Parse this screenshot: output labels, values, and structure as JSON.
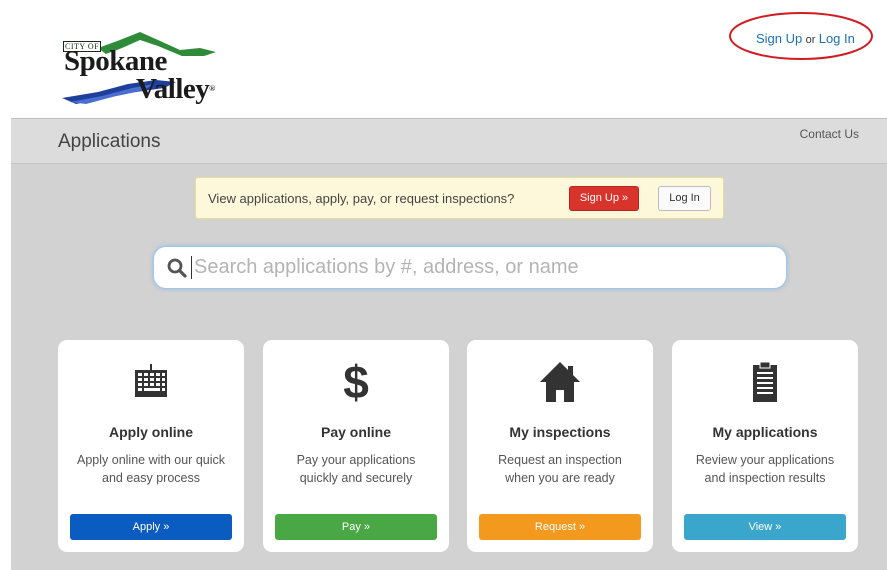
{
  "logo": {
    "city_of": "CITY OF",
    "line1": "Spokane",
    "line2": "Valley",
    "reg": "®"
  },
  "top_auth": {
    "signup": "Sign Up",
    "or": "or",
    "login": "Log In"
  },
  "header": {
    "title": "Applications",
    "contact": "Contact Us"
  },
  "banner": {
    "text": "View applications, apply, pay, or request inspections?",
    "signup_button": "Sign Up »",
    "login_button": "Log In"
  },
  "search": {
    "placeholder": "Search applications by #, address, or name",
    "value": ""
  },
  "cards": [
    {
      "icon": "keyboard-icon",
      "title": "Apply online",
      "desc1": "Apply online with our quick",
      "desc2": "and easy process",
      "button": "Apply »",
      "color": "#0b5cc0"
    },
    {
      "icon": "dollar-icon",
      "title": "Pay online",
      "desc1": "Pay your applications",
      "desc2": "quickly and securely",
      "button": "Pay »",
      "color": "#4aa745"
    },
    {
      "icon": "home-icon",
      "title": "My inspections",
      "desc1": "Request an inspection",
      "desc2": "when you are ready",
      "button": "Request »",
      "color": "#f39a1e"
    },
    {
      "icon": "clipboard-icon",
      "title": "My applications",
      "desc1": "Review your applications",
      "desc2": "and inspection results",
      "button": "View »",
      "color": "#3aa6cb"
    }
  ],
  "colors": {
    "background": "#d2d2d2",
    "link": "#1c6fb4",
    "annotation": "#d11c24"
  }
}
